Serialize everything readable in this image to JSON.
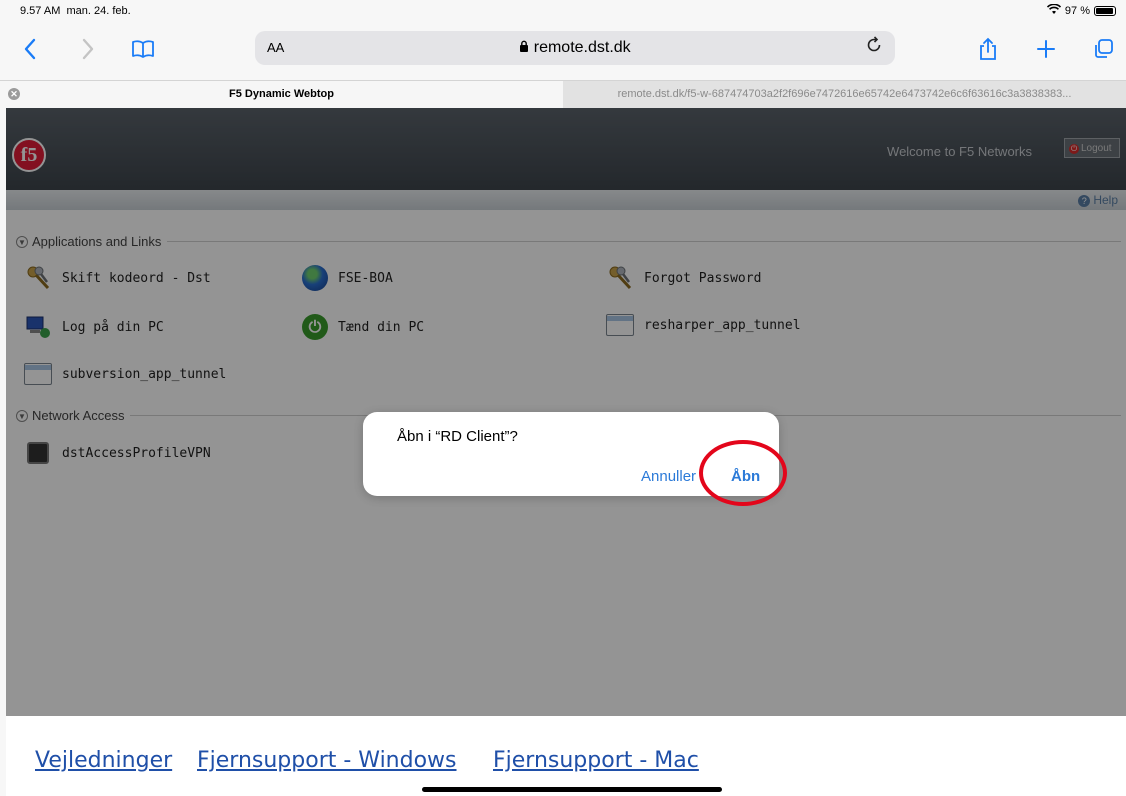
{
  "status_bar": {
    "time": "9.57 AM",
    "date": "man. 24. feb.",
    "battery": "97 %",
    "battery_level": 0.97
  },
  "toolbar": {
    "text_size_label": "AA",
    "address": "remote.dst.dk",
    "icons": [
      "back-icon",
      "forward-icon",
      "bookmarks-icon",
      "text-size-icon",
      "lock-icon",
      "reload-icon",
      "share-icon",
      "new-tab-icon",
      "tabs-icon"
    ]
  },
  "tabs": [
    {
      "title": "F5 Dynamic Webtop",
      "active": true
    },
    {
      "title": "remote.dst.dk/f5-w-687474703a2f2f696e7472616e65742e6473742e6c6f63616c3a3838383...",
      "active": false
    }
  ],
  "webtop": {
    "welcome": "Welcome to F5 Networks",
    "logout": "Logout",
    "help": "Help",
    "sections": {
      "applications": "Applications and Links",
      "network": "Network Access"
    },
    "apps": [
      {
        "label": "Skift kodeord - Dst",
        "icon": "keys-icon"
      },
      {
        "label": "FSE-BOA",
        "icon": "globe-icon"
      },
      {
        "label": "Forgot Password",
        "icon": "keys-icon"
      },
      {
        "label": "Log på din PC",
        "icon": "remote-pc-icon"
      },
      {
        "label": "Tænd din PC",
        "icon": "power-icon"
      },
      {
        "label": "resharper_app_tunnel",
        "icon": "window-icon"
      },
      {
        "label": "subversion_app_tunnel",
        "icon": "window-icon"
      }
    ],
    "network_items": [
      {
        "label": "dstAccessProfileVPN",
        "icon": "network-port-icon"
      }
    ],
    "footer_links": [
      "Vejledninger",
      "Fjernsupport - Windows",
      "Fjernsupport - Mac"
    ]
  },
  "dialog": {
    "message": "Åbn i “RD Client”?",
    "cancel": "Annuller",
    "open": "Åbn"
  },
  "colors": {
    "ios_blue": "#1a7cf7",
    "highlight_red": "#e3061b",
    "f5_red": "#e21d38"
  }
}
